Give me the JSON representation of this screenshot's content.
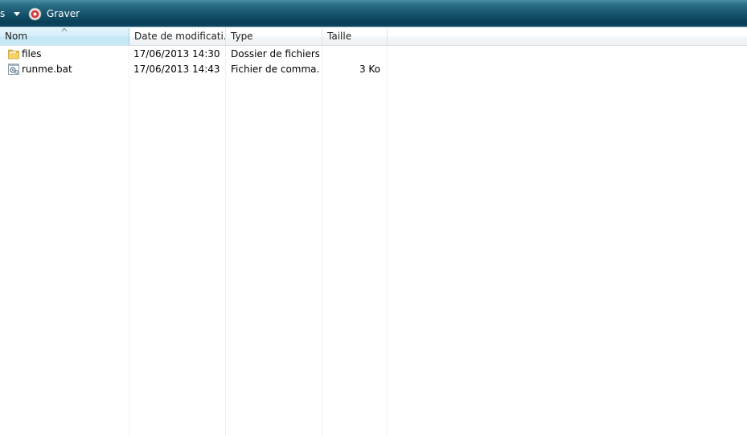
{
  "toolbar": {
    "cut_text": "s",
    "burn_label": "Graver"
  },
  "columns": {
    "name": "Nom",
    "date": "Date de modificati...",
    "type": "Type",
    "size": "Taille"
  },
  "files": [
    {
      "name": "files",
      "date": "17/06/2013 14:30",
      "type": "Dossier de fichiers",
      "size": "",
      "icon": "folder-icon"
    },
    {
      "name": "runme.bat",
      "date": "17/06/2013 14:43",
      "type": "Fichier de comma...",
      "size": "3 Ko",
      "icon": "batch-file-icon"
    }
  ],
  "colors": {
    "toolbar_dark": "#0a3f57",
    "toolbar_light": "#4a8fa6",
    "header_selected": "#c3e6f6"
  }
}
